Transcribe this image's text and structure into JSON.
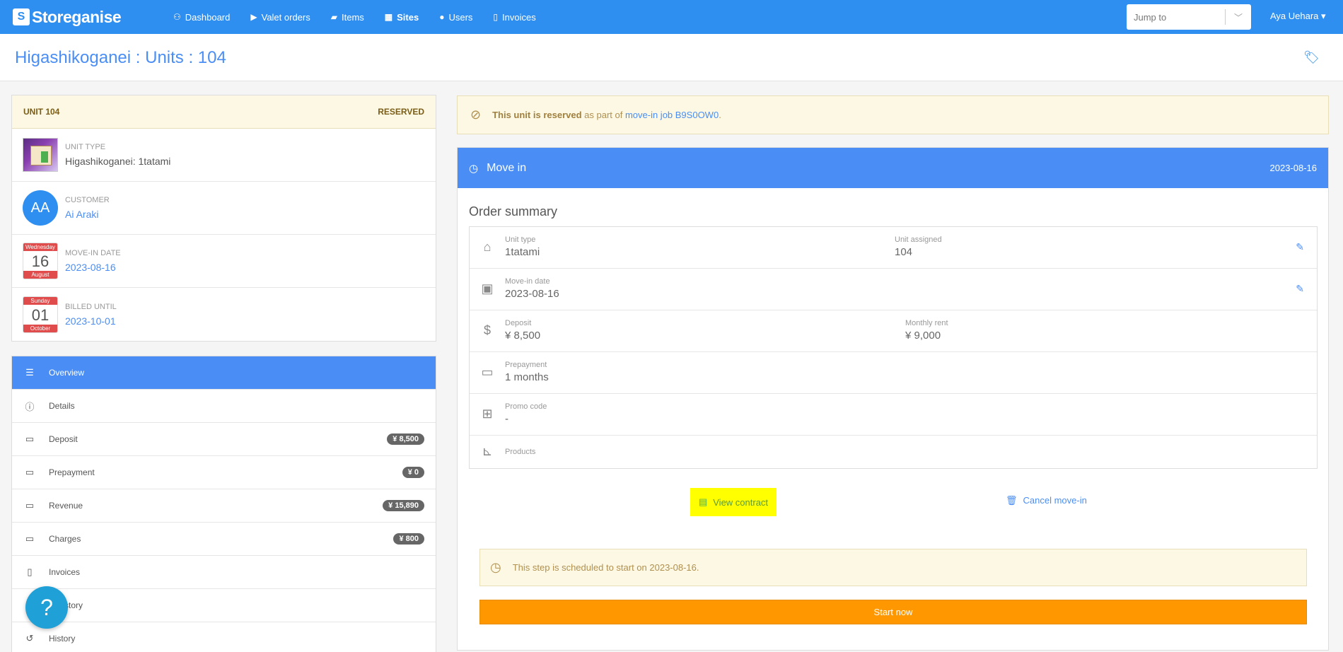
{
  "nav": {
    "brand": "Storeganise",
    "items": [
      {
        "label": "Dashboard",
        "icon": "sitemap-icon",
        "glyph": "⚇"
      },
      {
        "label": "Valet orders",
        "icon": "truck-icon",
        "glyph": "🚚"
      },
      {
        "label": "Items",
        "icon": "box-icon",
        "glyph": "▰"
      },
      {
        "label": "Sites",
        "icon": "building-icon",
        "glyph": "▦"
      },
      {
        "label": "Users",
        "icon": "user-icon",
        "glyph": "👤"
      },
      {
        "label": "Invoices",
        "icon": "file-icon",
        "glyph": "🗎"
      }
    ],
    "jump_placeholder": "Jump to",
    "user_name": "Aya Uehara ▾"
  },
  "page": {
    "title": "Higashikoganei : Units : 104"
  },
  "unit": {
    "header_left": "UNIT 104",
    "header_right": "RESERVED",
    "type_label": "UNIT TYPE",
    "type_value": "Higashikoganei: 1tatami",
    "customer_label": "CUSTOMER",
    "customer_initials": "AA",
    "customer_value": "Ai Araki",
    "movein_label": "MOVE-IN DATE",
    "movein_cal": {
      "weekday": "Wednesday",
      "day": "16",
      "month": "August"
    },
    "movein_value": "2023-08-16",
    "billed_label": "BILLED UNTIL",
    "billed_cal": {
      "weekday": "Sunday",
      "day": "01",
      "month": "October"
    },
    "billed_value": "2023-10-01"
  },
  "menu": {
    "items": [
      {
        "label": "Overview",
        "glyph": "☰",
        "badge": ""
      },
      {
        "label": "Details",
        "glyph": "ⓘ",
        "badge": ""
      },
      {
        "label": "Deposit",
        "glyph": "▭",
        "badge": "¥ 8,500"
      },
      {
        "label": "Prepayment",
        "glyph": "▭",
        "badge": "¥ 0"
      },
      {
        "label": "Revenue",
        "glyph": "▭",
        "badge": "¥ 15,890"
      },
      {
        "label": "Charges",
        "glyph": "▭",
        "badge": "¥ 800"
      },
      {
        "label": "Invoices",
        "glyph": "🗎",
        "badge": ""
      },
      {
        "label": "al history",
        "glyph": "⚇",
        "badge": ""
      },
      {
        "label": "History",
        "glyph": "↺",
        "badge": ""
      }
    ]
  },
  "help": {
    "label": "?"
  },
  "alert": {
    "strong": "This unit is reserved",
    "middle": " as part of ",
    "link": "move-in job B9S0OW0",
    "end": "."
  },
  "movein": {
    "title": "Move in",
    "date": "2023-08-16",
    "summary_title": "Order summary",
    "rows": {
      "unit_type_label": "Unit type",
      "unit_type_value": "1tatami",
      "unit_assigned_label": "Unit assigned",
      "unit_assigned_value": "104",
      "movein_date_label": "Move-in date",
      "movein_date_value": "2023-08-16",
      "deposit_label": "Deposit",
      "deposit_value": "¥ 8,500",
      "monthly_rent_label": "Monthly rent",
      "monthly_rent_value": "¥ 9,000",
      "prepayment_label": "Prepayment",
      "prepayment_value": "1 months",
      "promo_label": "Promo code",
      "promo_value": "-",
      "products_label": "Products"
    },
    "view_contract": "View contract",
    "cancel_movein": "Cancel move-in",
    "step_notice": "This step is scheduled to start on 2023-08-16.",
    "start_now": "Start now"
  }
}
